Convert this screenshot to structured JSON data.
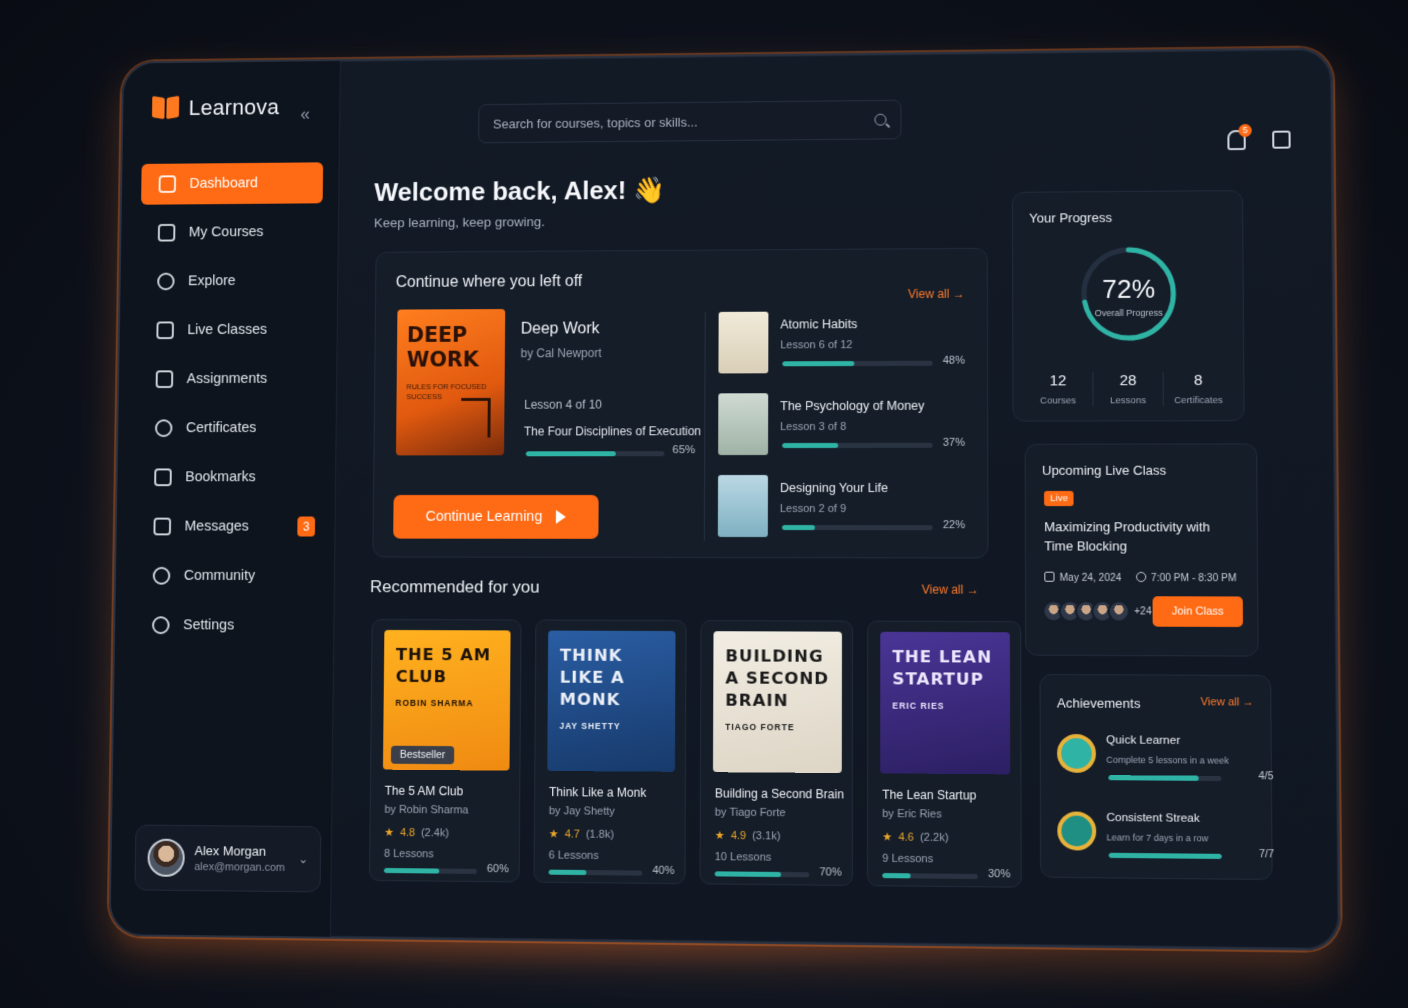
{
  "app": {
    "name": "Learnova"
  },
  "sidebar": {
    "items": [
      {
        "label": "Dashboard",
        "icon": "home-icon",
        "active": true
      },
      {
        "label": "My Courses",
        "icon": "courses-icon"
      },
      {
        "label": "Explore",
        "icon": "search-icon"
      },
      {
        "label": "Live Classes",
        "icon": "calendar-icon"
      },
      {
        "label": "Assignments",
        "icon": "document-icon"
      },
      {
        "label": "Certificates",
        "icon": "award-icon"
      },
      {
        "label": "Bookmarks",
        "icon": "bookmark-icon"
      },
      {
        "label": "Messages",
        "icon": "mail-icon",
        "badge": "3"
      },
      {
        "label": "Community",
        "icon": "users-icon"
      },
      {
        "label": "Settings",
        "icon": "gear-icon"
      }
    ],
    "user": {
      "name": "Alex Morgan",
      "email": "alex@morgan.com"
    }
  },
  "search": {
    "placeholder": "Search for courses, topics or skills..."
  },
  "notifications": {
    "count": "5"
  },
  "welcome": {
    "title": "Welcome back, Alex! 👋",
    "subtitle": "Keep learning, keep growing."
  },
  "continue": {
    "title": "Continue where you left off",
    "view_all": "View all",
    "featured": {
      "cover_title": "DEEP WORK",
      "cover_subtitle": "RULES FOR FOCUSED SUCCESS",
      "title": "Deep Work",
      "author": "by Cal Newport",
      "lesson": "Lesson 4 of 10",
      "chapter": "The Four Disciplines of Execution",
      "progress": 65,
      "progress_label": "65%",
      "button": "Continue Learning"
    },
    "list": [
      {
        "title": "Atomic Habits",
        "lesson": "Lesson 6 of 12",
        "progress": 48,
        "progress_label": "48%"
      },
      {
        "title": "The Psychology of Money",
        "lesson": "Lesson 3 of 8",
        "progress": 37,
        "progress_label": "37%"
      },
      {
        "title": "Designing Your Life",
        "lesson": "Lesson 2 of 9",
        "progress": 22,
        "progress_label": "22%"
      }
    ]
  },
  "recommended": {
    "title": "Recommended for you",
    "view_all": "View all",
    "books": [
      {
        "cover_title": "THE 5 AM CLUB",
        "cover_author": "ROBIN SHARMA",
        "badge": "Bestseller",
        "title": "The 5 AM Club",
        "author": "by Robin Sharma",
        "rating": "4.8",
        "reviews": "(2.4k)",
        "lessons": "8 Lessons",
        "progress": 60,
        "progress_label": "60%",
        "color": "#f5a21a"
      },
      {
        "cover_title": "THINK LIKE A MONK",
        "cover_author": "JAY SHETTY",
        "title": "Think Like a Monk",
        "author": "by Jay Shetty",
        "rating": "4.7",
        "reviews": "(1.8k)",
        "lessons": "6 Lessons",
        "progress": 40,
        "progress_label": "40%",
        "color": "#1f4f8f"
      },
      {
        "cover_title": "BUILDING A SECOND BRAIN",
        "cover_author": "TIAGO FORTE",
        "title": "Building a Second Brain",
        "author": "by Tiago Forte",
        "rating": "4.9",
        "reviews": "(3.1k)",
        "lessons": "10 Lessons",
        "progress": 70,
        "progress_label": "70%",
        "color": "#ece6da"
      },
      {
        "cover_title": "THE LEAN STARTUP",
        "cover_author": "ERIC RIES",
        "title": "The Lean Startup",
        "author": "by Eric Ries",
        "rating": "4.6",
        "reviews": "(2.2k)",
        "lessons": "9 Lessons",
        "progress": 30,
        "progress_label": "30%",
        "color": "#3b2a7a"
      }
    ]
  },
  "progress_card": {
    "title": "Your Progress",
    "percent": 72,
    "percent_label": "72%",
    "label": "Overall Progress",
    "stats": [
      {
        "value": "12",
        "label": "Courses"
      },
      {
        "value": "28",
        "label": "Lessons"
      },
      {
        "value": "8",
        "label": "Certificates"
      }
    ]
  },
  "live_class": {
    "title": "Upcoming Live Class",
    "badge": "Live",
    "name": "Maximizing Productivity with Time Blocking",
    "date": "May 24, 2024",
    "time": "7:00 PM - 8:30 PM",
    "more": "+24",
    "button": "Join Class"
  },
  "achievements": {
    "title": "Achievements",
    "view_all": "View all",
    "items": [
      {
        "name": "Quick Learner",
        "desc": "Complete 5 lessons in a week",
        "value": "4/5",
        "progress": 80
      },
      {
        "name": "Consistent Streak",
        "desc": "Learn for 7 days in a row",
        "value": "7/7",
        "progress": 100
      }
    ]
  },
  "colors": {
    "accent": "#ff6a14",
    "teal": "#2fb3a4",
    "panel": "#151d29"
  }
}
